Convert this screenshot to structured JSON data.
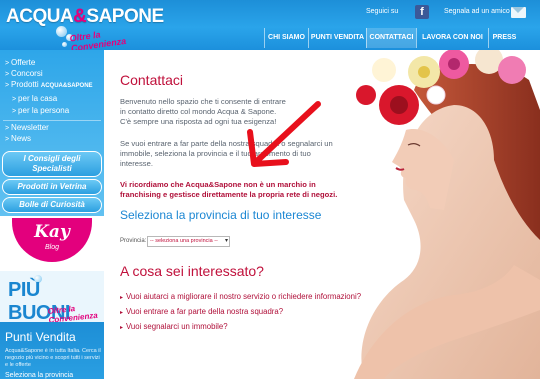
{
  "brand": {
    "name_left": "ACQUA",
    "amp": "&",
    "name_right": "SAPONE",
    "tagline": "Oltre la Convenienza"
  },
  "top_links": {
    "follow": "Seguici su",
    "share": "Segnala ad un amico"
  },
  "nav": [
    "CHI SIAMO",
    "PUNTI VENDITA",
    "CONTATTACI",
    "LAVORA CON NOI",
    "PRESS"
  ],
  "nav_active": "CONTATTACI",
  "sidebar": {
    "items": [
      "Offerte",
      "Concorsi"
    ],
    "products_label": "Prodotti",
    "products_brand": "ACQUA&SAPONE",
    "sub_items": [
      "per la casa",
      "per la persona"
    ],
    "items_after": [
      "Newsletter",
      "News"
    ],
    "promos": [
      "I Consigli degli Specialisti",
      "Prodotti in Vetrina",
      "Bolle di Curiosità"
    ],
    "kay": {
      "name": "Kay",
      "sub": "Blog"
    },
    "piu_buoni": {
      "title": "PIÙ BUONI",
      "tagline": "Oltre la Convenienza"
    },
    "punti_vendita": {
      "title": "Punti Vendita",
      "description": "Acqua&Sapone è in tutta Italia. Cerca il negozio più vicino e scopri tutti i servizi e le offerte",
      "select_label": "Seleziona la provincia"
    }
  },
  "main": {
    "title": "Contattaci",
    "intro": [
      "Benvenuto nello spazio che ti consente di entrare",
      "in contatto diretto col mondo Acqua & Sapone.",
      "C'è sempre una risposta ad ogni tua esigenza!"
    ],
    "paragraph2": [
      "Se vuoi entrare a far parte della nostra squadra o segnalarci un",
      "immobile, seleziona la provincia e il tuo argomento di tuo",
      "interesse."
    ],
    "notice": [
      "Vi ricordiamo che Acqua&Sapone non è un marchio in",
      "franchising e gestisce direttamente la propria rete di negozi."
    ],
    "province_heading": "Seleziona la provincia di tuo interesse",
    "province_label": "Provincia:",
    "province_placeholder": "-- seleziona una provincia --",
    "interest_heading": "A cosa sei interessato?",
    "options": [
      "Vuoi aiutarci a migliorare il nostro servizio o richiedere informazioni?",
      "Vuoi entrare a far parte della nostra squadra?",
      "Vuoi segnalarci un immobile?"
    ]
  },
  "colors": {
    "brand_blue": "#1d8fd8",
    "brand_magenta": "#e3007d",
    "heading_red": "#c0103b",
    "arrow_red": "#e8101c"
  },
  "icons": [
    "facebook-icon",
    "mail-icon",
    "arrow-right-icon"
  ]
}
